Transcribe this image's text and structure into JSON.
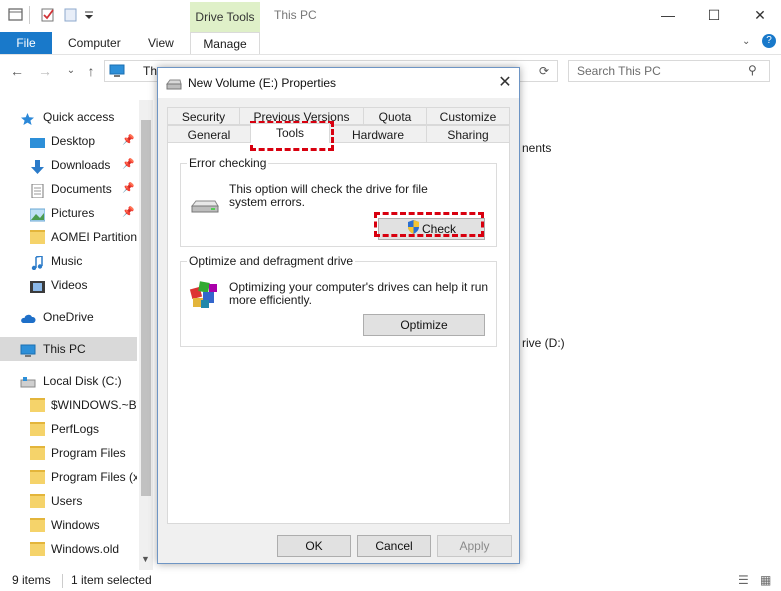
{
  "titlebar": {
    "context_tab": "Drive Tools",
    "window_title": "This PC",
    "minimize": "—",
    "maximize": "☐",
    "close": "✕"
  },
  "ribbon": {
    "file": "File",
    "tabs": [
      "Computer",
      "View"
    ],
    "manage": "Manage"
  },
  "address": {
    "path_fragment": "Th",
    "search_placeholder": "Search This PC"
  },
  "sidebar": {
    "items": [
      {
        "label": "Quick access",
        "icon": "star-icon"
      },
      {
        "label": "Desktop",
        "icon": "desktop-icon",
        "pinned": true
      },
      {
        "label": "Downloads",
        "icon": "download-arrow-icon",
        "pinned": true
      },
      {
        "label": "Documents",
        "icon": "documents-icon",
        "pinned": true
      },
      {
        "label": "Pictures",
        "icon": "pictures-icon",
        "pinned": true
      },
      {
        "label": "AOMEI Partition",
        "icon": "folder-icon"
      },
      {
        "label": "Music",
        "icon": "music-icon"
      },
      {
        "label": "Videos",
        "icon": "videos-icon"
      },
      {
        "label": "OneDrive",
        "icon": "cloud-icon"
      },
      {
        "label": "This PC",
        "icon": "computer-icon"
      },
      {
        "label": "Local Disk (C:)",
        "icon": "drive-icon"
      },
      {
        "label": "$WINDOWS.~BT",
        "icon": "folder-icon"
      },
      {
        "label": "PerfLogs",
        "icon": "folder-icon"
      },
      {
        "label": "Program Files",
        "icon": "folder-icon"
      },
      {
        "label": "Program Files (x",
        "icon": "folder-icon"
      },
      {
        "label": "Users",
        "icon": "folder-icon"
      },
      {
        "label": "Windows",
        "icon": "folder-icon"
      },
      {
        "label": "Windows.old",
        "icon": "folder-icon"
      }
    ]
  },
  "main": {
    "peek_devices": "nents",
    "peek_drive": "rive (D:)"
  },
  "status": {
    "items": "9 items",
    "selected": "1 item selected"
  },
  "dialog": {
    "title": "New Volume (E:) Properties",
    "tabs_row1": [
      "Security",
      "Previous Versions",
      "Quota",
      "Customize"
    ],
    "tabs_row2": [
      "General",
      "Tools",
      "Hardware",
      "Sharing"
    ],
    "active_tab": "Tools",
    "error_group": {
      "title": "Error checking",
      "text_line1": "This option will check the drive for file",
      "text_line2": "system errors.",
      "button": "Check"
    },
    "optimize_group": {
      "title": "Optimize and defragment drive",
      "text_line1": "Optimizing your computer's drives can help it run",
      "text_line2": "more efficiently.",
      "button": "Optimize"
    },
    "buttons": {
      "ok": "OK",
      "cancel": "Cancel",
      "apply": "Apply"
    }
  },
  "colors": {
    "file_tab": "#1979ca",
    "context_tab": "#dff0c8",
    "highlight": "#d8000f",
    "selection": "#d9d9d9"
  }
}
